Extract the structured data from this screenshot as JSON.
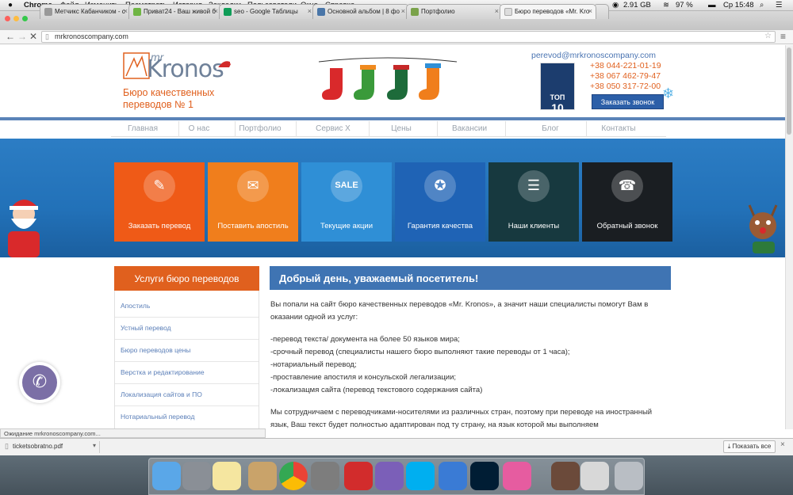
{
  "menubar": {
    "apple": "",
    "items": [
      "Chrome",
      "Файл",
      "Изменить",
      "Посмотреть",
      "История",
      "Закладки",
      "Пользователи",
      "Окно",
      "Справка"
    ],
    "memory": "2.91 GB",
    "battery": "97 %",
    "clock": "Ср 15:48"
  },
  "tabs": [
    {
      "label": "Метчикс Кабанчиком - с"
    },
    {
      "label": "Приват24 - Ваш живой б"
    },
    {
      "label": "seo - Google Таблицы"
    },
    {
      "label": "Основной альбом | 8 фо"
    },
    {
      "label": "Портфолио"
    },
    {
      "label": "Бюро переводов «Mr. Kro"
    }
  ],
  "address": {
    "url": "mrkronoscompany.com"
  },
  "header": {
    "logo_mr": "mr",
    "logo_word": "Kronos",
    "tagline": "Бюро качественных переводов № 1",
    "email": "perevod@mrkronoscompany.com",
    "phones": [
      "+38 044-221-01-19",
      "+38 067 462-79-47",
      "+38 050 317-72-00"
    ],
    "call_button": "Заказать звонок",
    "badge_top": "ТОП",
    "badge_num": "10"
  },
  "nav": {
    "items": [
      "Главная",
      "О нас",
      "Портфолио",
      "Сервис X",
      "Цены",
      "Вакансии",
      "Блог",
      "Контакты"
    ]
  },
  "tiles": [
    {
      "label": "Заказать перевод",
      "color": "#ef5a17",
      "icon": "form-icon"
    },
    {
      "label": "Поставить апостиль",
      "color": "#f07e1c",
      "icon": "certificate-icon"
    },
    {
      "label": "Текущие акции",
      "color": "#2f8fd6",
      "icon": "sale-icon"
    },
    {
      "label": "Гарантия качества",
      "color": "#1f63b5",
      "icon": "medal-icon"
    },
    {
      "label": "Наши клиенты",
      "color": "#17393f",
      "icon": "address-book-icon"
    },
    {
      "label": "Обратный звонок",
      "color": "#1a1e22",
      "icon": "phone-book-icon"
    }
  ],
  "tile_glyphs": [
    "✎",
    "✉",
    "SALE",
    "✪",
    "☰",
    "☎"
  ],
  "sidebar": {
    "title": "Услуги бюро переводов",
    "items": [
      "Апостиль",
      "Устный перевод",
      "Бюро переводов цены",
      "Верстка и редактирование",
      "Локализация сайтов и ПО",
      "Нотариальный перевод"
    ]
  },
  "content": {
    "heading": "Добрый день, уважаемый посетитель!",
    "intro": "Вы попали на сайт бюро качественных переводов «Mr. Kronos», а значит наши специалисты помогут Вам в оказании одной из услуг:",
    "bullets": [
      "-перевод текста/ документа на более 50 языков мира;",
      "-срочный перевод (специалисты нашего бюро выполняют такие переводы от 1 часа);",
      "-нотариальный перевод;",
      "-проставление апостиля и консульской легализации;",
      "-локализацмя сайта (перевод текстового содержания сайта)"
    ],
    "para2": "Мы сотрудничаем с переводчиками-носителями из различных стран, поэтому при переводе на иностранный язык, Ваш текст будет полностью адаптирован под ту страну, на язык которой мы выполняем"
  },
  "status_bar": "Ожидание mrkronoscompany.com...",
  "download": {
    "file": "ticketsobratno.pdf",
    "show_all": "Показать все"
  },
  "dock": [
    "finder",
    "launchpad",
    "notes",
    "mail",
    "chrome",
    "system-prefs",
    "parallels",
    "viber",
    "skype",
    "openoffice",
    "photoshop",
    "itunes",
    "photos",
    "preview",
    "trash"
  ]
}
